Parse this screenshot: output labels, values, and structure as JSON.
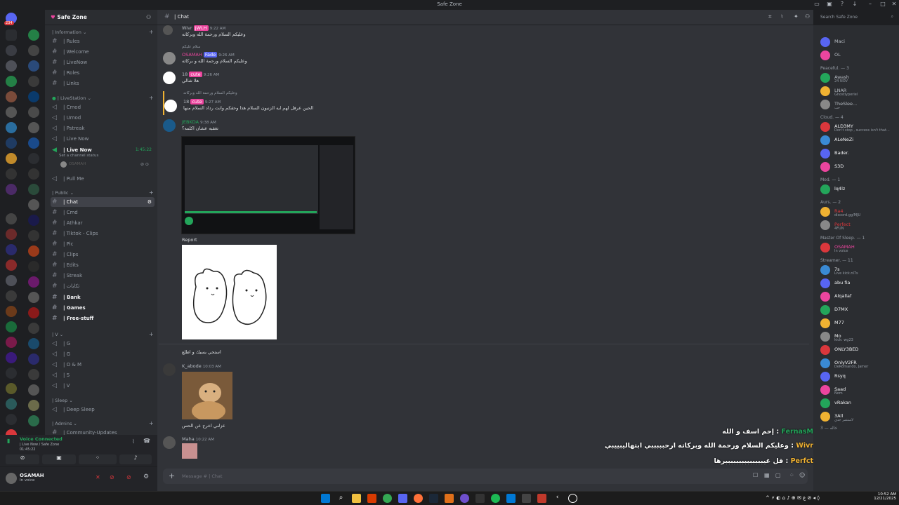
{
  "window": {
    "title": "Safe Zone"
  },
  "server": {
    "name": "Safe Zone"
  },
  "servers_badges": [
    "234",
    "85",
    "33",
    "148",
    "29",
    "219"
  ],
  "categories": {
    "information": "| Information",
    "livestation": "| LiveStation",
    "public": "| Public",
    "v": "| V",
    "sleep": "| Sleep",
    "admins": "| Admins"
  },
  "channels": {
    "information": [
      "| Rules",
      "| Welcome",
      "| LiveNow",
      "| Roles",
      "| Links"
    ],
    "livestation": [
      "| Cmod",
      "| Umod",
      "| Pstreak",
      "| Live Now",
      "| Live Now"
    ],
    "live_time": "1:45:22",
    "channel_status": "Set a channel status",
    "pull_me": "| Pull Me",
    "public": [
      "| Chat",
      "| Cmd",
      "| Athkar",
      "| Tiktok - Clips",
      "| Pic",
      "| Clips",
      "| Edits",
      "| Streak",
      "| ئكايات",
      "| Bank",
      "| Games",
      "| Free-stuff"
    ],
    "v": [
      "| G",
      "| G",
      "| O & M",
      "| S",
      "| V"
    ],
    "sleep": [
      "| Deep Sleep"
    ],
    "admins": [
      "| Community-Updates"
    ]
  },
  "voice": {
    "status": "Voice Connected",
    "location": "| Live Now / Safe Zone",
    "time": "01:45:22"
  },
  "user": {
    "name": "OSAMAH",
    "status": "In voice"
  },
  "chat": {
    "channel": "| Chat",
    "input_placeholder": "Message #   | Chat",
    "report_label": "Report",
    "messages": [
      {
        "user": "Wivr",
        "tag": "JWLH",
        "time": "9:22 AM",
        "text": "وعليكم السلام ورحمة الله وبركاته"
      },
      {
        "user": "OSAMAH",
        "tag": "Fade",
        "time": "9:26 AM",
        "text": "وعليكم السلام ورحمة الله و بركاته",
        "reply": "سلام عليكم"
      },
      {
        "user": "18",
        "tag": "cute",
        "time": "9:26 AM",
        "text": "هلا شالي"
      },
      {
        "user": "18",
        "tag": "cute",
        "time": "9:27 AM",
        "text": "الحين عرفل لهم ايه الزنبون السلام هذا وحقكم وانت رداد السلام منها",
        "reply": "وعليكم السلام ورحمة الله وبركاته"
      },
      {
        "user": "JEBKDA",
        "tag": "",
        "time": "9:38 AM",
        "text": "تغقبه عشان اكلمه؟"
      },
      {
        "user": "",
        "tag": "",
        "time": "",
        "text": "استحي بسيك و اطلع"
      },
      {
        "user": "K_abode",
        "tag": "",
        "time": "10:03 AM",
        "text": "عزلني اخرج عن الحس"
      },
      {
        "user": "Maha",
        "tag": "",
        "time": "10:22 AM",
        "text": ""
      }
    ]
  },
  "search": {
    "placeholder": "Search Safe Zone"
  },
  "members": {
    "top": [
      {
        "name": "Maci",
        "sub": ""
      },
      {
        "name": "OL",
        "sub": ""
      }
    ],
    "sections": [
      {
        "title": "Peaceful. — 3",
        "members": [
          {
            "name": "Awash",
            "sub": "24 NOV"
          },
          {
            "name": "LNAR",
            "sub": "Ghostlyperiel"
          },
          {
            "name": "TheSlee...",
            "sub": "حب"
          }
        ]
      },
      {
        "title": "Cloud. — 4",
        "members": [
          {
            "name": "ALD3MY",
            "sub": "Don't stop , success isn't that..."
          },
          {
            "name": "ALeNeZi",
            "sub": ""
          },
          {
            "name": "Bader.",
            "sub": ""
          },
          {
            "name": "S3D",
            "sub": ""
          }
        ]
      },
      {
        "title": "Mod. — 1",
        "members": [
          {
            "name": "lq4lz",
            "sub": ""
          }
        ]
      },
      {
        "title": "Aurs. — 2",
        "members": [
          {
            "name": "Ra4",
            "sub": "discord.gg/MJU"
          },
          {
            "name": "Perfect",
            "sub": "4FUN"
          }
        ]
      },
      {
        "title": "Master Of Sleep. — 1",
        "members": [
          {
            "name": "OSAMAH",
            "sub": "In voice"
          }
        ]
      },
      {
        "title": "Streamer. — 11",
        "members": [
          {
            "name": "7s",
            "sub": "Live kick.nl7s"
          },
          {
            "name": "abu fia",
            "sub": ""
          },
          {
            "name": "Alqallaf",
            "sub": ""
          },
          {
            "name": "D7MX",
            "sub": ""
          },
          {
            "name": "M77",
            "sub": ""
          },
          {
            "name": "Mo",
            "sub": "kick: wg23"
          },
          {
            "name": "ONLY3BED",
            "sub": ""
          },
          {
            "name": "OnlyV2FR",
            "sub": "DeRomando, Jamer"
          },
          {
            "name": "Rsyq",
            "sub": ""
          },
          {
            "name": "Saad",
            "sub": "Nom"
          },
          {
            "name": "vRakan",
            "sub": ""
          },
          {
            "name": "3All",
            "sub": "لاستثمر جدي"
          }
        ]
      }
    ],
    "bottom_section": "خاله — 3"
  },
  "overlay": {
    "lines": [
      {
        "user": "FernasM",
        "text": "إحم اسف و الله :"
      },
      {
        "user": "Wivr",
        "text": "وعليكم السلام ورحمة الله وبركاته ارحبببببي ابتهاليبييبي :"
      },
      {
        "user": "Perfct",
        "text": "قل غيببببببببببببببرها :"
      }
    ]
  },
  "clock": {
    "time": "10:52 AM",
    "date": "12/21/2025"
  },
  "colors": {
    "bg": "#1e1f22",
    "sidebar": "#2b2d31",
    "main": "#313338",
    "accent": "#5865f2",
    "green": "#23a55a",
    "pink": "#eb459e"
  }
}
